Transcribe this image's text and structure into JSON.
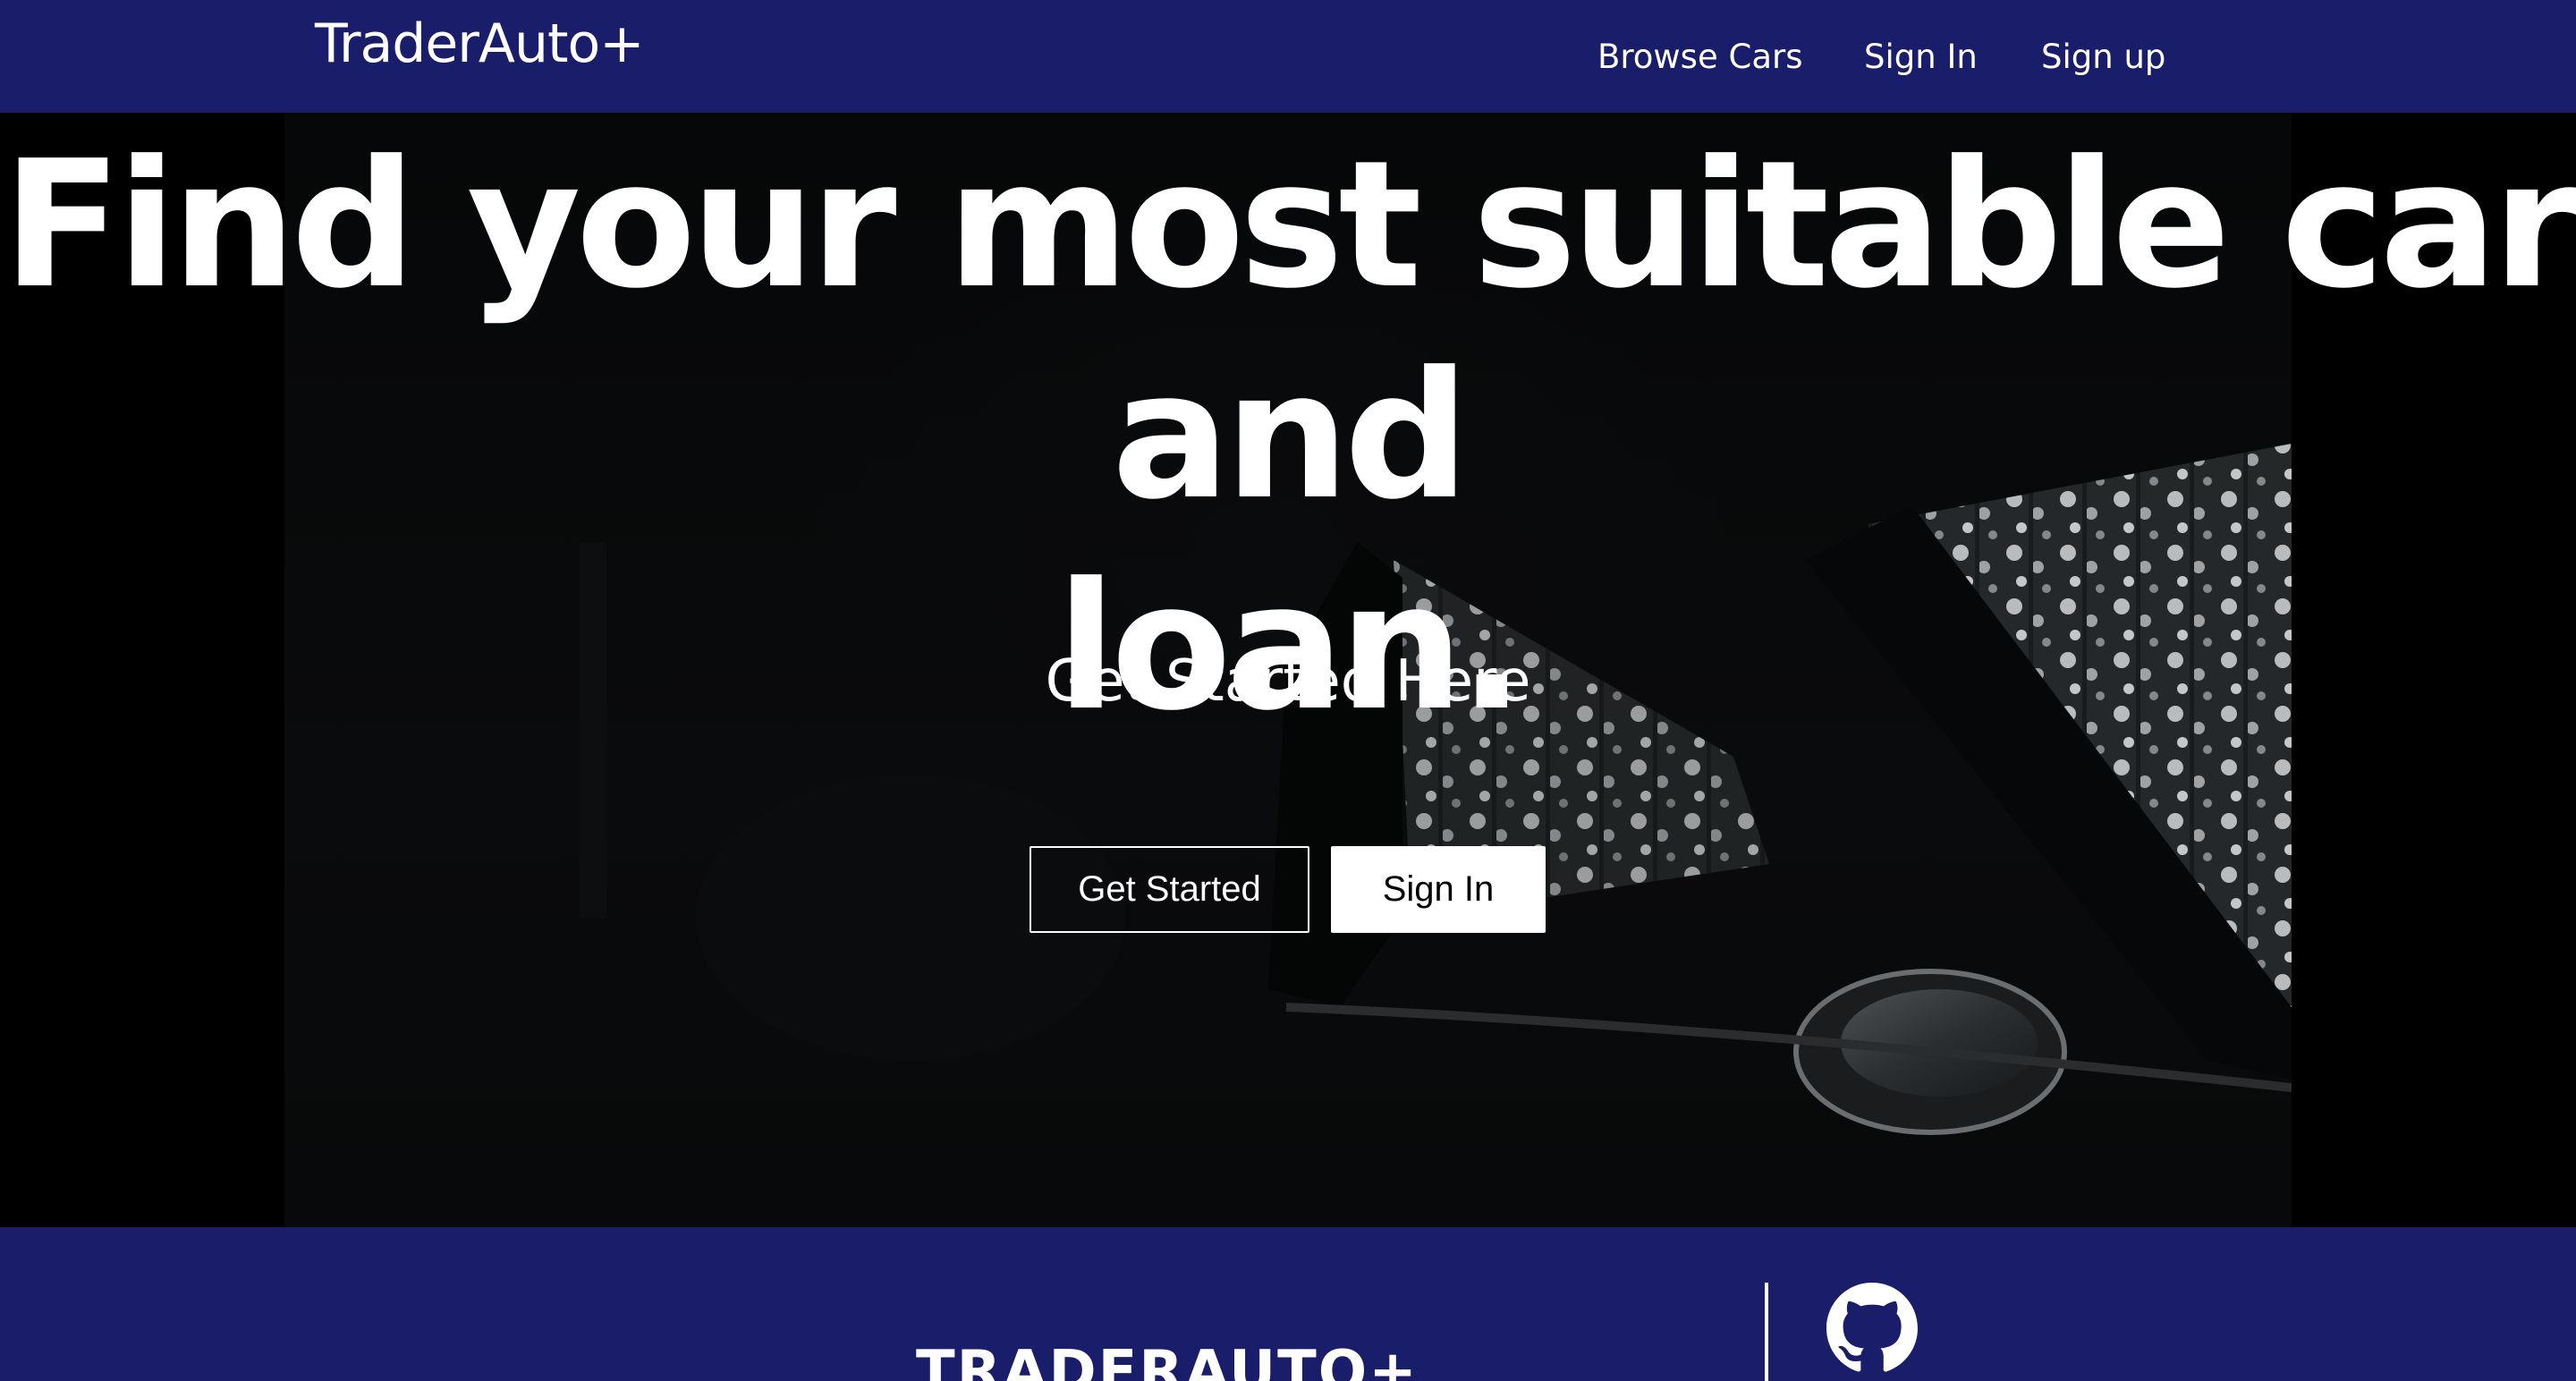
{
  "navbar": {
    "brand": "TraderAuto+",
    "links": [
      {
        "label": "Browse Cars"
      },
      {
        "label": "Sign In"
      },
      {
        "label": "Sign up"
      }
    ],
    "background": "#1a1d6a"
  },
  "hero": {
    "headline_line1": "Find your most suitable car and",
    "headline_line2": "loan.",
    "subheading": "Get Started Here",
    "buttons": {
      "get_started": "Get Started",
      "sign_in": "Sign In"
    }
  },
  "footer": {
    "brand": "TRADERAUTO+",
    "icon": "github-icon",
    "background": "#1a1d6a"
  }
}
